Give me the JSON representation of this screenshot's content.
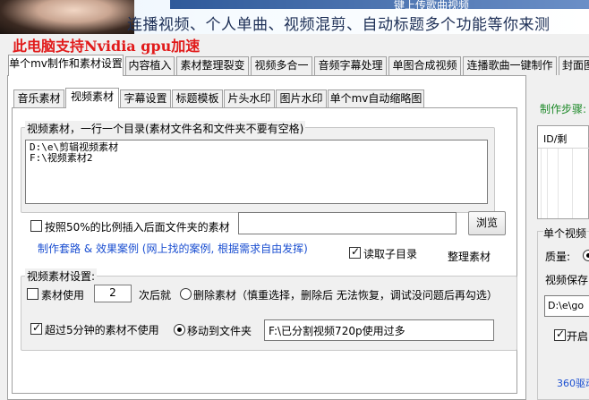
{
  "banner": {
    "top_strip_text": "键上传歌曲视频",
    "tagline": "连播视频、个人单曲、视频混剪、自动标题多个功能等你来测"
  },
  "gpu_title": "此电脑支持Nvidia gpu加速",
  "top_tabs": [
    {
      "label": "单个mv制作和素材设置",
      "active": true
    },
    {
      "label": "内容植入"
    },
    {
      "label": "素材整理裂变"
    },
    {
      "label": "视频多合一"
    },
    {
      "label": "音频字幕处理"
    },
    {
      "label": "单图合成视频"
    },
    {
      "label": "连播歌曲一键制作"
    },
    {
      "label": "封面图"
    }
  ],
  "sub_tabs": [
    {
      "label": "音乐素材"
    },
    {
      "label": "视频素材",
      "active": true
    },
    {
      "label": "字幕设置"
    },
    {
      "label": "标题模板"
    },
    {
      "label": "片头水印"
    },
    {
      "label": "图片水印"
    },
    {
      "label": "单个mv自动缩略图"
    }
  ],
  "video_group": {
    "label": "视频素材，一行一个目录(素材文件名和文件夹不要有空格)",
    "directories": "D:\\e\\剪辑视频素材\nF:\\视频素材2"
  },
  "ratio_option": {
    "label": "按照50%的比例插入后面文件夹的素材",
    "checked": false,
    "path_value": "",
    "browse_label": "浏览"
  },
  "links": {
    "case_link": "制作套路 & 效果案例 (网上找的案例, 根据需求自由发挥)"
  },
  "read_subdir": {
    "label": "读取子目录",
    "checked": true
  },
  "organize_label": "整理素材",
  "settings_group": {
    "label": "视频素材设置:",
    "use_count_label": "素材使用",
    "use_count_checked": false,
    "use_count_value": "2",
    "after_label": "次后就",
    "delete_label": "删除素材（慎重选择，删除后 无法恢复，调试没问题后再勾选）",
    "delete_selected": false,
    "skip_long_label": "超过5分钟的素材不使用",
    "skip_long_checked": true,
    "move_label": "移动到文件夹",
    "move_selected": true,
    "move_path": "F:\\已分割视频720p使用过多"
  },
  "right_panel": {
    "steps_label": "制作步骤:",
    "list_header": "ID/剩",
    "group_label": "单个视频",
    "quality_label": "质量:",
    "save_label": "视频保存",
    "save_path": "D:\\e\\go",
    "open_label": "开启(",
    "footer_link": "360驱动"
  },
  "colors": {
    "accent_red": "#e11a1a",
    "link_blue": "#1b4fd1",
    "steps_green": "#1f8a2a"
  }
}
